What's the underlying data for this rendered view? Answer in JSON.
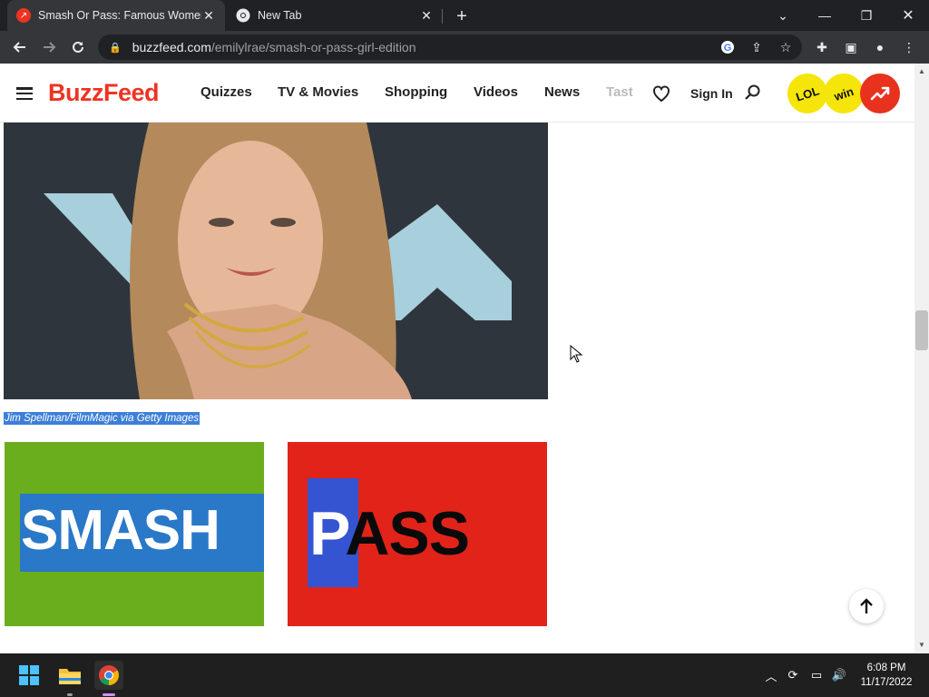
{
  "browser": {
    "tabs": [
      {
        "title": "Smash Or Pass: Famous Women E",
        "active": true
      },
      {
        "title": "New Tab",
        "active": false
      }
    ],
    "url_host": "buzzfeed.com",
    "url_path": "/emilylrae/smash-or-pass-girl-edition"
  },
  "site": {
    "logo": "BuzzFeed",
    "nav": [
      "Quizzes",
      "TV & Movies",
      "Shopping",
      "Videos",
      "News",
      "Tasty"
    ],
    "sign_in": "Sign In",
    "badges": [
      "LOL",
      "win"
    ],
    "colors": {
      "brand": "#ee3322",
      "badge_yellow": "#f5e50a",
      "trending_red": "#e8321e"
    }
  },
  "article": {
    "image_credit": "Jim Spellman/FilmMagic via Getty Images",
    "choices": [
      {
        "label": "SMASH",
        "color": "#6aae1e"
      },
      {
        "label": "PASS",
        "color": "#e2231a"
      }
    ]
  },
  "taskbar": {
    "time": "6:08 PM",
    "date": "11/17/2022"
  },
  "icons": [
    "back-icon",
    "forward-icon",
    "reload-icon",
    "lock-icon",
    "google-icon",
    "share-icon",
    "star-icon",
    "extensions-icon",
    "sidepanel-icon",
    "profile-icon",
    "menu-icon",
    "heart-icon",
    "search-icon",
    "trending-icon",
    "scroll-top-icon",
    "windows-start-icon",
    "file-explorer-icon",
    "chrome-icon"
  ]
}
